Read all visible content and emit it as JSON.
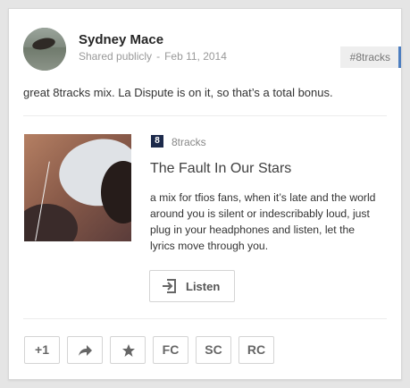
{
  "post": {
    "author": "Sydney Mace",
    "visibility": "Shared publicly",
    "separator": "-",
    "date": "Feb 11, 2014",
    "hashtag": "#8tracks",
    "text": "great 8tracks mix. La Dispute is on it, so that’s a total bonus."
  },
  "link": {
    "site_icon_glyph": "8",
    "site_name": "8tracks",
    "title": "The Fault In Our Stars",
    "description": "a mix for tfios fans, when it’s late and the world around you is silent or indescribably loud, just plug in your headphones and listen, let the lyrics move through you.",
    "listen_label": "Listen"
  },
  "actions": {
    "plus_one": "+1",
    "fc": "FC",
    "sc": "SC",
    "rc": "RC"
  },
  "colors": {
    "accent": "#4d7ec0",
    "site_icon": "#1c2a4b"
  }
}
